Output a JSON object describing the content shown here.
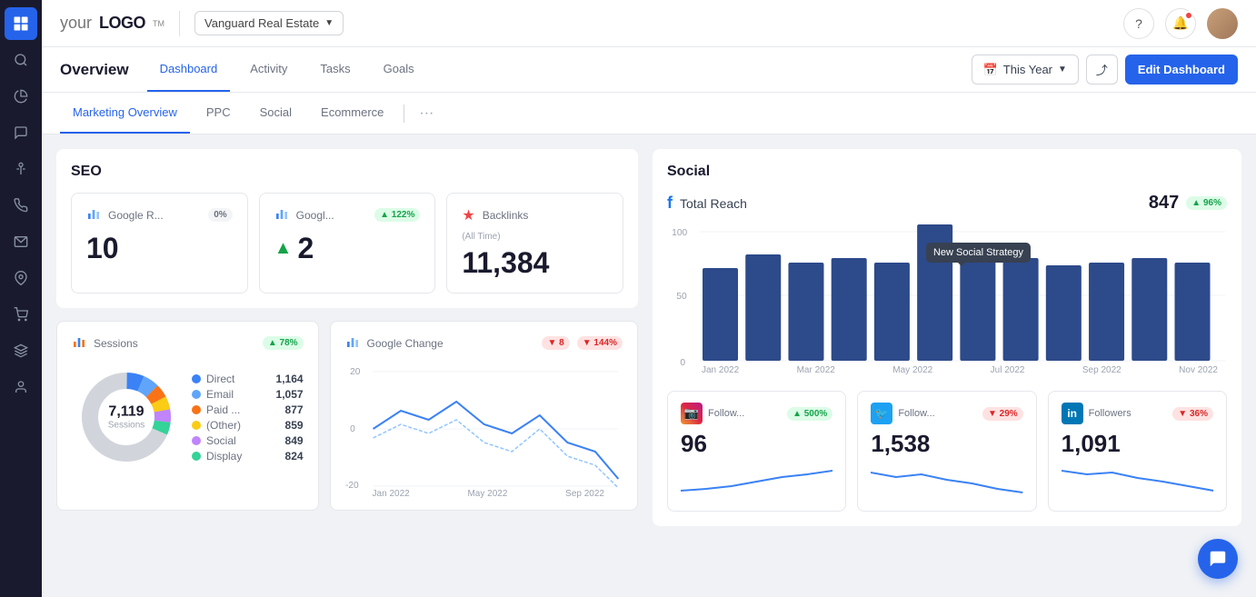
{
  "header": {
    "logo_your": "your",
    "logo_logo": "LOGO",
    "logo_tm": "TM",
    "company": "Vanguard Real Estate",
    "help_icon": "?",
    "has_notification": true
  },
  "nav": {
    "title": "Overview",
    "tabs": [
      {
        "label": "Dashboard",
        "active": true
      },
      {
        "label": "Activity",
        "active": false
      },
      {
        "label": "Tasks",
        "active": false
      },
      {
        "label": "Goals",
        "active": false
      }
    ],
    "date_filter": "This Year",
    "edit_label": "Edit Dashboard"
  },
  "sub_nav": {
    "tabs": [
      {
        "label": "Marketing Overview",
        "active": true
      },
      {
        "label": "PPC",
        "active": false
      },
      {
        "label": "Social",
        "active": false
      },
      {
        "label": "Ecommerce",
        "active": false
      }
    ]
  },
  "seo": {
    "title": "SEO",
    "google_rank": {
      "label": "Google R...",
      "badge": "0%",
      "badge_type": "neutral",
      "value": "10"
    },
    "google_change_card": {
      "label": "Googl...",
      "badge": "122%",
      "badge_type": "up",
      "value": "2"
    },
    "backlinks": {
      "label": "Backlinks",
      "subtitle": "(All Time)",
      "value": "11,384"
    },
    "sessions": {
      "label": "Sessions",
      "badge": "78%",
      "badge_type": "up",
      "total": "7,119",
      "total_label": "Sessions",
      "legend": [
        {
          "color": "#3b82f6",
          "label": "Direct",
          "value": "1,164"
        },
        {
          "color": "#60a5fa",
          "label": "Email",
          "value": "1,057"
        },
        {
          "color": "#f97316",
          "label": "Paid ...",
          "value": "877"
        },
        {
          "color": "#facc15",
          "label": "(Other)",
          "value": "859"
        },
        {
          "color": "#c084fc",
          "label": "Social",
          "value": "849"
        },
        {
          "color": "#34d399",
          "label": "Display",
          "value": "824"
        }
      ]
    },
    "google_change_chart": {
      "label": "Google Change",
      "badge1": "8",
      "badge1_type": "down",
      "badge2": "144%",
      "badge2_type": "down",
      "y_max": 20,
      "y_mid": 0,
      "y_min": -20,
      "x_labels": [
        "Jan 2022",
        "May 2022",
        "Sep 2022"
      ]
    }
  },
  "social": {
    "title": "Social",
    "total_reach": {
      "label": "Total Reach",
      "value": "847",
      "badge": "96%",
      "badge_type": "up",
      "tooltip": "New Social Strategy",
      "x_labels": [
        "Jan 2022",
        "Mar 2022",
        "May 2022",
        "Jul 2022",
        "Sep 2022",
        "Nov 2022"
      ],
      "y_labels": [
        "100",
        "50",
        "0"
      ],
      "bars": [
        68,
        78,
        72,
        75,
        72,
        100,
        78,
        75,
        70,
        72,
        75,
        72
      ]
    },
    "instagram": {
      "label": "Follow...",
      "badge": "500%",
      "badge_type": "up",
      "value": "96"
    },
    "twitter": {
      "label": "Follow...",
      "badge": "29%",
      "badge_type": "down",
      "value": "1,538"
    },
    "linkedin": {
      "label": "Followers",
      "badge": "36%",
      "badge_type": "down",
      "value": "1,091"
    }
  },
  "sidebar_icons": [
    "grid",
    "search",
    "pie",
    "chat",
    "pin",
    "phone",
    "mail",
    "map",
    "cart",
    "layers",
    "user"
  ],
  "chat_bubble_icon": "💬"
}
